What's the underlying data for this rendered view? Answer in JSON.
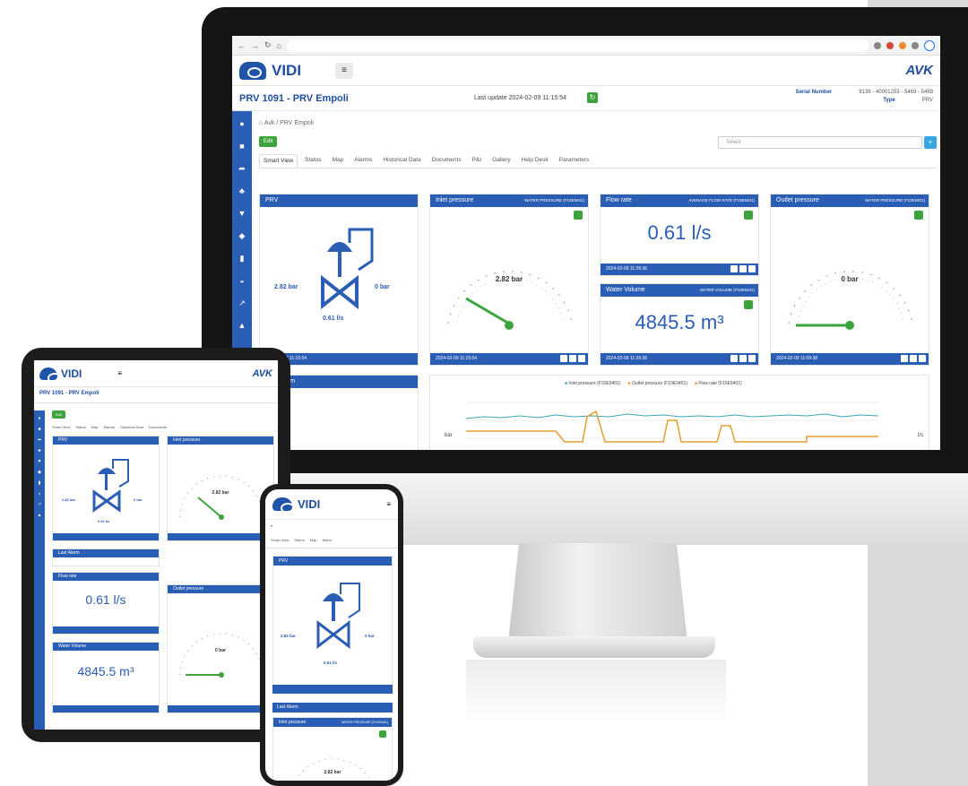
{
  "app": {
    "logo": "VIDI",
    "brand": "AVK",
    "menu_icon": "hamburger-icon"
  },
  "desktop": {
    "page_title": "PRV 1091 - PRV Empoli",
    "last_update": "Last update 2024-02-09 11:15:54",
    "serial_label": "Serial Number",
    "serial_value": "9139 - 40001253 - 5469 - 5469",
    "type_label": "Type",
    "type_value": "PRV",
    "breadcrumb": "Avk / PRV Empoli",
    "edit_label": "Edit",
    "select_placeholder": "Select",
    "tabs": [
      "Smart View",
      "Status",
      "Map",
      "Alarms",
      "Historical Data",
      "Documents",
      "P&I",
      "Gallery",
      "Help Desk",
      "Parameters"
    ],
    "cards": {
      "prv": {
        "title": "PRV",
        "left_pressure": "2.82 bar",
        "right_pressure": "0 bar",
        "flow": "0.61 l/s",
        "footer": "2024-02-09 11:15:54"
      },
      "inlet": {
        "title": "Inlet pressure",
        "tag": "WATER PRESSURE (F10E9401)",
        "value": "2.82 bar",
        "footer": "2024-02-09 11:15:54"
      },
      "flow": {
        "title": "Flow rate",
        "tag": "AVERAGE FLOW RATE (F10E9401)",
        "value": "0.61 l/s",
        "footer": "2024-02-09 11:26:36"
      },
      "volume": {
        "title": "Water Volume",
        "tag": "WATER VOLUME (F10E9401)",
        "value": "4845.5 m³",
        "footer": "2024-02-09 11:26:36"
      },
      "outlet": {
        "title": "Outlet pressure",
        "tag": "WATER PRESSURE (F10E9401)",
        "value": "0 bar",
        "footer": "2024-02-09 11:09:38"
      },
      "alarm": {
        "title": "Last Alarm"
      }
    },
    "chart_legend": [
      "Inlet pressure (F10E9401)",
      "Outlet pressure (F10E9401)",
      "Flow rate (F10E9401)"
    ],
    "chart_axis_left": "bar",
    "chart_axis_right": "l/s"
  },
  "tablet": {
    "page_title": "PRV 1091 - PRV Empoli",
    "edit_label": "Edit",
    "tabs": [
      "Smart View",
      "Status",
      "Map",
      "Alarms",
      "Historical Data",
      "Documents"
    ],
    "prv_title": "PRV",
    "inlet_title": "Inlet pressure",
    "inlet_value": "2.82 bar",
    "alarm_title": "Last Alarm",
    "flow_title": "Flow rate",
    "flow_value": "0.61 l/s",
    "outlet_title": "Outlet pressure",
    "outlet_value": "0 bar",
    "volume_title": "Water Volume",
    "volume_value": "4845.5 m³",
    "left_pressure": "2.82 bar",
    "right_pressure": "0 bar",
    "flow": "0.61 l/s"
  },
  "phone": {
    "logo": "VIDI",
    "tabs": [
      "Smart View",
      "Status",
      "Map",
      "Alarm"
    ],
    "prv_title": "PRV",
    "left_pressure": "2.82 bar",
    "right_pressure": "0 bar",
    "flow": "0.61 l/s",
    "alarm_title": "Last Alarm",
    "inlet_title": "Inlet pressure",
    "inlet_tag": "WATER PRESSURE (F10E9401)",
    "inlet_value": "2.82 bar"
  },
  "colors": {
    "primary": "#2a5db4",
    "accent_green": "#3da33d",
    "chart_inlet": "#3ba7b8",
    "chart_outlet": "#e0a030",
    "chart_flow": "#c9a060"
  }
}
